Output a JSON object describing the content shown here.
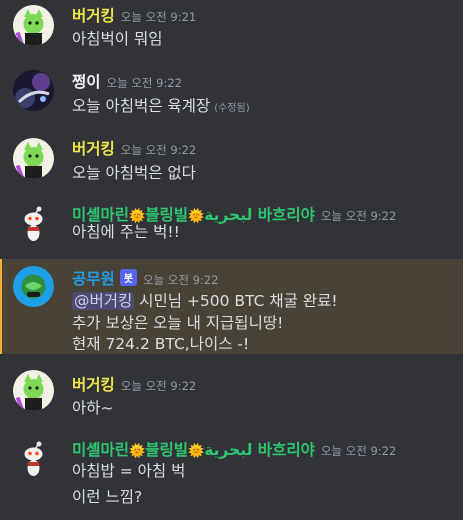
{
  "colors": {
    "background": "#313338",
    "text": "#dbdee1",
    "timestamp": "#949ba4",
    "user_burger": "#f0e64a",
    "user_jjeong": "#f2f3f5",
    "user_mishel": "#2dc770",
    "user_gongmuwon": "#1e9fe8",
    "mention_highlight": "#f0b132",
    "bot_tag": "#5865f2"
  },
  "messages": [
    {
      "username": "버거킹",
      "timestamp": "오늘 오전 9:21",
      "avatar_icon": "green-cat-avatar-icon",
      "lines": [
        "아침벅이 뭐임"
      ]
    },
    {
      "username": "쩡이",
      "timestamp": "오늘 오전 9:22",
      "avatar_icon": "dark-cosmic-avatar-icon",
      "lines": [
        "오늘 아침벅은  육계장"
      ],
      "edited": "(수정됨)"
    },
    {
      "username": "버거킹",
      "timestamp": "오늘 오전 9:22",
      "avatar_icon": "green-cat-avatar-icon",
      "lines": [
        "오늘 아침벅은 없다"
      ]
    },
    {
      "username_part1": "미셸마린",
      "username_emoji1": "🌞",
      "username_part2": "블링빌",
      "username_emoji2": "🌞",
      "username_arabic": "لبحرية",
      "username_part3": "바흐리야",
      "timestamp": "오늘 오전 9:22",
      "avatar_icon": "reddit-snoo-avatar-icon",
      "lines": [
        "아침에 주는 벅!!"
      ]
    },
    {
      "username": "공무원",
      "bot_tag": "봇",
      "timestamp": "오늘 오전 9:22",
      "avatar_icon": "bot-globe-avatar-icon",
      "mention": "@버거킹",
      "line1_rest": " 시민님 +500 BTC 채굴 완료!",
      "lines": [
        "추가 보상은 오늘 내 지급됩니땅!",
        "현재 724.2 BTC,나이스 -!"
      ]
    },
    {
      "username": "버거킹",
      "timestamp": "오늘 오전 9:22",
      "avatar_icon": "green-cat-avatar-icon",
      "lines": [
        "아하~"
      ]
    },
    {
      "username_part1": "미셸마린",
      "username_emoji1": "🌞",
      "username_part2": "블링빌",
      "username_emoji2": "🌞",
      "username_arabic": "لبحرية",
      "username_part3": "바흐리야",
      "timestamp": "오늘 오전 9:22",
      "avatar_icon": "reddit-snoo-avatar-icon",
      "lines": [
        "아침밥 = 아침 벅",
        "이런 느낌?"
      ]
    }
  ]
}
